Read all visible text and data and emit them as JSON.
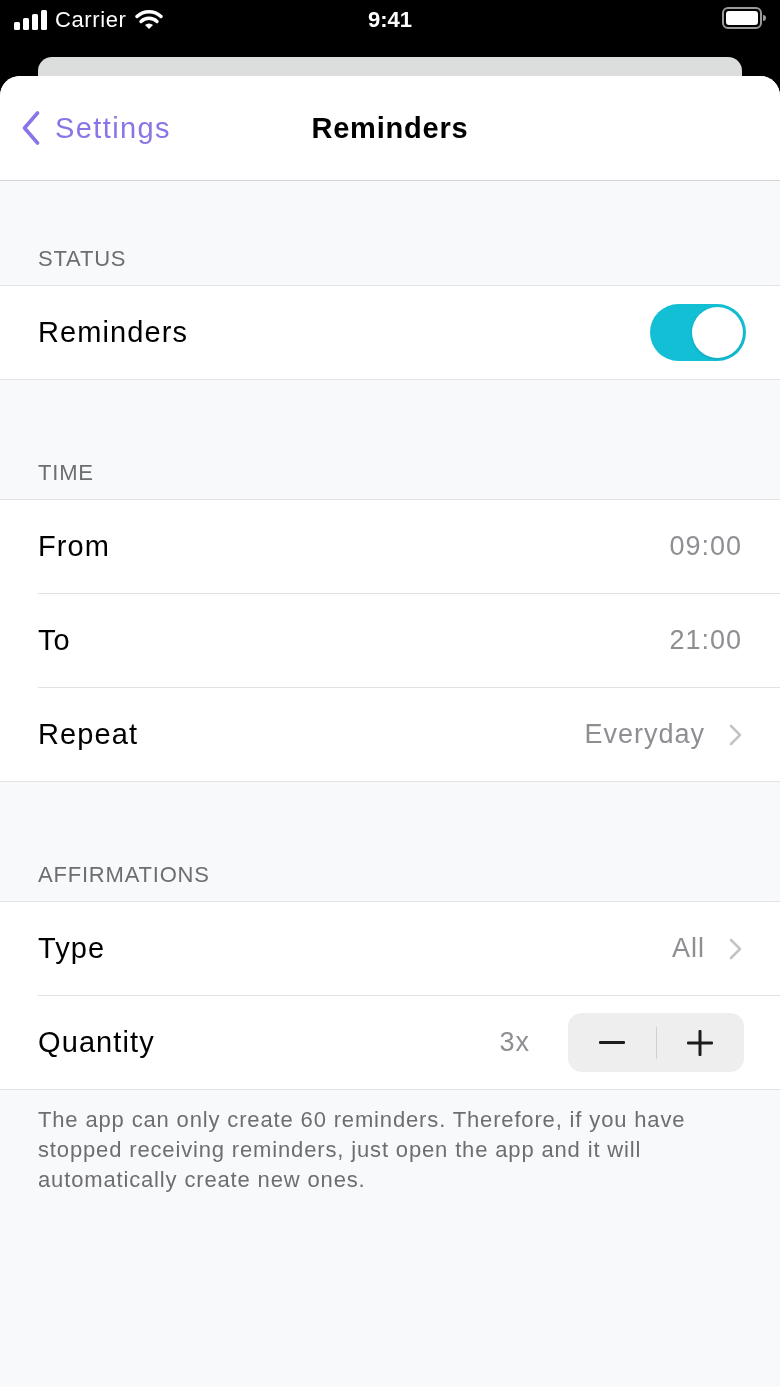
{
  "status_bar": {
    "carrier": "Carrier",
    "time": "9:41"
  },
  "nav": {
    "back_label": "Settings",
    "title": "Reminders"
  },
  "sections": [
    {
      "header": "STATUS",
      "rows": [
        {
          "kind": "toggle",
          "label": "Reminders",
          "on": true
        }
      ]
    },
    {
      "header": "TIME",
      "rows": [
        {
          "kind": "value",
          "label": "From",
          "value": "09:00"
        },
        {
          "kind": "value",
          "label": "To",
          "value": "21:00"
        },
        {
          "kind": "disclosure",
          "label": "Repeat",
          "value": "Everyday"
        }
      ]
    },
    {
      "header": "AFFIRMATIONS",
      "rows": [
        {
          "kind": "disclosure",
          "label": "Type",
          "value": "All"
        },
        {
          "kind": "stepper",
          "label": "Quantity",
          "value": "3x"
        }
      ],
      "footer": "The app can only create 60 reminders. Therefore, if you have stopped receiving reminders, just open the app and it will automatically create new ones."
    }
  ]
}
